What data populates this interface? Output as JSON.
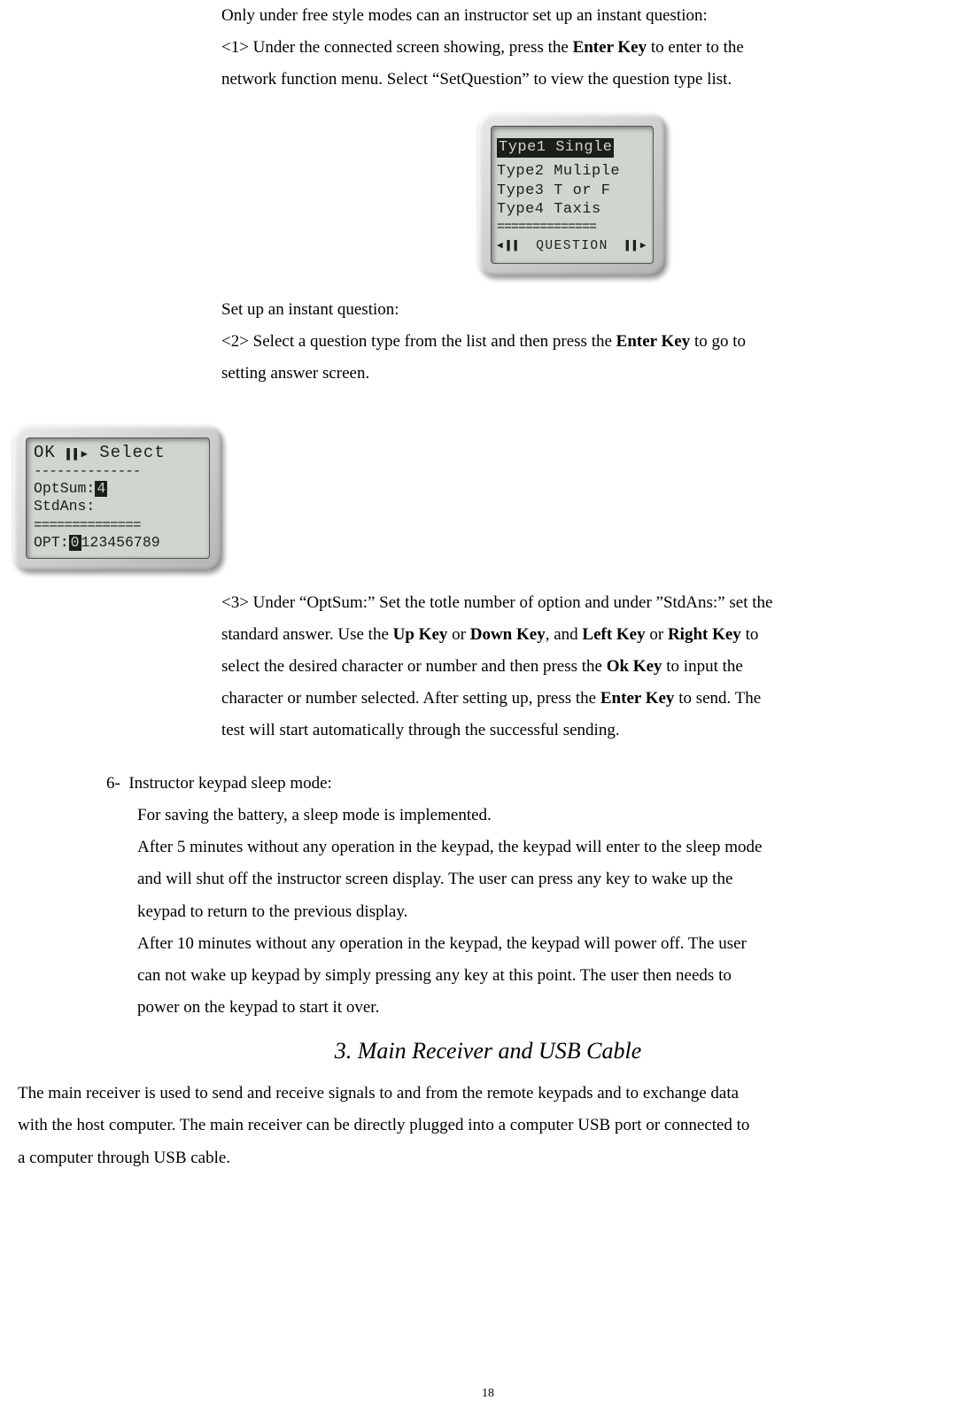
{
  "para1_line1": "Only under free style modes can an instructor set up an instant question:",
  "para1_step1_a": "<1> Under the connected screen showing, press the ",
  "para1_step1_bold": "Enter Key",
  "para1_step1_b": " to enter to the",
  "para1_step1_c": "network function menu. Select “SetQuestion” to view the question type list.",
  "device1": {
    "line1": "Type1 Single",
    "line2": "Type2 Muliple",
    "line3": "Type3 T or F",
    "line4": "Type4 Taxis",
    "separator": "==============",
    "footer_left": "◀▐▐",
    "footer_text": "QUESTION",
    "footer_right": "▌▌▶"
  },
  "para2_line1": "Set up an instant question:",
  "para2_step2_a": "<2> Select a question type from the list and then press the ",
  "para2_step2_bold": "Enter Key",
  "para2_step2_b": " to go to",
  "para2_step2_c": "setting answer screen.",
  "device2": {
    "top_ok": "OK",
    "top_arrows": "▌▌▶",
    "top_select": "Select",
    "dashes": "--------------",
    "optsum_label": "OptSum:",
    "optsum_val": "4",
    "stdans": "StdAns:",
    "sep": "==============",
    "opt_label": "OPT:",
    "opt_selected": "0",
    "opt_rest": "123456789"
  },
  "para3_a": "<3> Under “OptSum:” Set the totle number of option and under ”StdAns:” set the",
  "para3_b_pre": "standard answer. Use the ",
  "para3_b_up": "Up Key",
  "para3_b_or1": " or ",
  "para3_b_down": "Down Key",
  "para3_b_and": ", and ",
  "para3_b_left": "Left Key",
  "para3_b_or2": " or ",
  "para3_b_right": "Right Key",
  "para3_b_post": " to",
  "para3_c_pre": "select the desired character or number and then press the ",
  "para3_c_ok": "Ok Key",
  "para3_c_post": " to input the",
  "para3_d_pre": "character or number selected. After setting up, press the ",
  "para3_d_enter": "Enter Key",
  "para3_d_post": " to send.    The",
  "para3_e": "test will start automatically through the successful sending.",
  "item6_num": "6-",
  "item6_title": "Instructor keypad sleep mode:",
  "item6_l1": "For saving the battery, a sleep mode is implemented.",
  "item6_l2": "After 5 minutes without any operation in the keypad, the keypad will enter to the sleep mode",
  "item6_l3": "and will shut off the instructor screen display. The user can press any key to wake up the",
  "item6_l4": "keypad to return to the previous display.",
  "item6_l5": "After 10 minutes without any operation in the keypad, the keypad will power off. The user",
  "item6_l6": "can not wake up keypad by simply pressing any key at this point. The user then needs to",
  "item6_l7": "power on the keypad to start it over.",
  "section3_heading": "3. Main Receiver and USB Cable",
  "section3_p1": "The main receiver is used to send and receive signals to and from the remote keypads and to exchange data",
  "section3_p2": "with the host computer. The main receiver can be directly plugged into a computer USB port or connected to",
  "section3_p3": "a computer through USB cable.",
  "page_number": "18"
}
